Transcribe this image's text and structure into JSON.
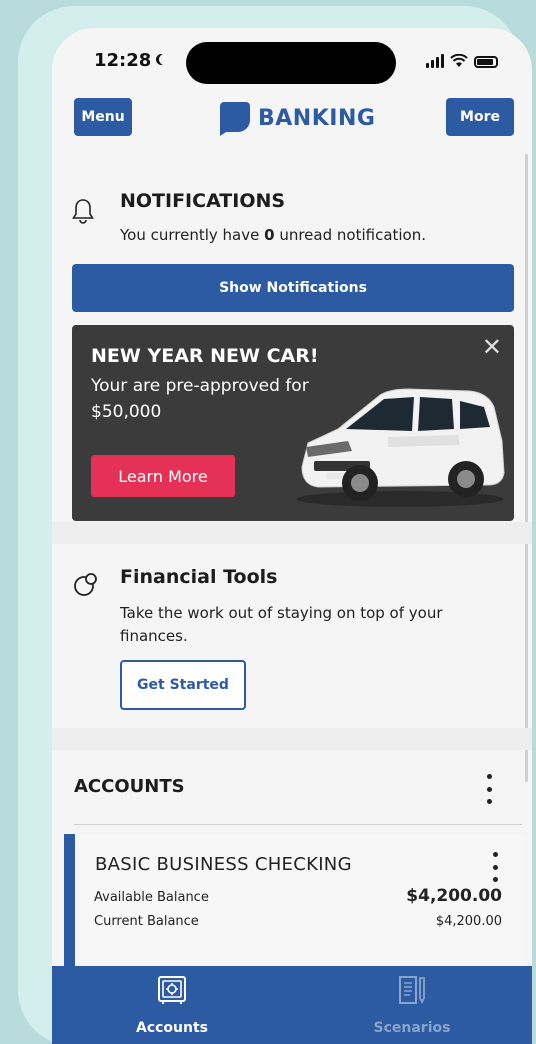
{
  "status_bar": {
    "time": "12:28"
  },
  "header": {
    "menu_label": "Menu",
    "brand": "BANKING",
    "more_label": "More"
  },
  "notifications": {
    "title": "NOTIFICATIONS",
    "text_before": "You currently have ",
    "unread_count": "0",
    "text_after": " unread notification.",
    "button_label": "Show Notifications"
  },
  "promo": {
    "title": "NEW YEAR NEW CAR!",
    "subtitle": "Your are pre-approved for $50,000",
    "button_label": "Learn More",
    "close_glyph": "✕"
  },
  "financial_tools": {
    "title": "Financial Tools",
    "text": "Take the work out of staying on top of your finances.",
    "button_label": "Get Started"
  },
  "accounts": {
    "title": "ACCOUNTS",
    "items": [
      {
        "name": "BASIC BUSINESS CHECKING",
        "available_label": "Available Balance",
        "available_value": "$4,200.00",
        "current_label": "Current Balance",
        "current_value": "$4,200.00"
      }
    ]
  },
  "tabbar": {
    "tabs": [
      {
        "label": "Accounts",
        "icon": "vault-icon",
        "active": true
      },
      {
        "label": "Scenarios",
        "icon": "document-pen-icon",
        "active": false
      }
    ]
  },
  "colors": {
    "brand_blue": "#2d5ba3",
    "promo_red": "#e43155",
    "background": "#b8dcdb"
  }
}
